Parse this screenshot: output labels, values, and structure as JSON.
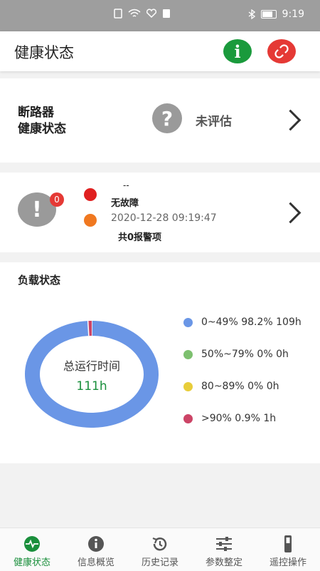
{
  "status_bar": {
    "time": "9:19"
  },
  "app": {
    "title": "健康状态"
  },
  "breaker_card": {
    "label_line1": "断路器",
    "label_line2": "健康状态",
    "status": "未评估"
  },
  "alarm_card": {
    "badge_count": "0",
    "dash": "--",
    "title": "无故障",
    "time": "2020-12-28 09:19:47",
    "count_text": "共0报警项"
  },
  "load": {
    "title": "负载状态",
    "center_label": "总运行时间",
    "center_value": "111h",
    "legend": [
      {
        "text": "0~49%   98.2% 109h",
        "color": "#6a96e6"
      },
      {
        "text": "50%~79%   0% 0h",
        "color": "#7dc06f"
      },
      {
        "text": "80~89%   0% 0h",
        "color": "#e8cd3a"
      },
      {
        "text": ">90%   0.9% 1h",
        "color": "#cc4466"
      }
    ]
  },
  "chart_data": {
    "type": "pie",
    "categories": [
      "0~49%",
      "50%~79%",
      "80~89%",
      ">90%"
    ],
    "values": [
      98.2,
      0,
      0,
      0.9
    ],
    "colors": [
      "#6a96e6",
      "#7dc06f",
      "#e8cd3a",
      "#cc4466"
    ]
  },
  "nav": [
    {
      "label": "健康状态",
      "icon": "heart-pulse-icon",
      "active": true
    },
    {
      "label": "信息概览",
      "icon": "info-icon"
    },
    {
      "label": "历史记录",
      "icon": "history-icon"
    },
    {
      "label": "参数整定",
      "icon": "sliders-icon"
    },
    {
      "label": "遥控操作",
      "icon": "remote-icon"
    }
  ]
}
